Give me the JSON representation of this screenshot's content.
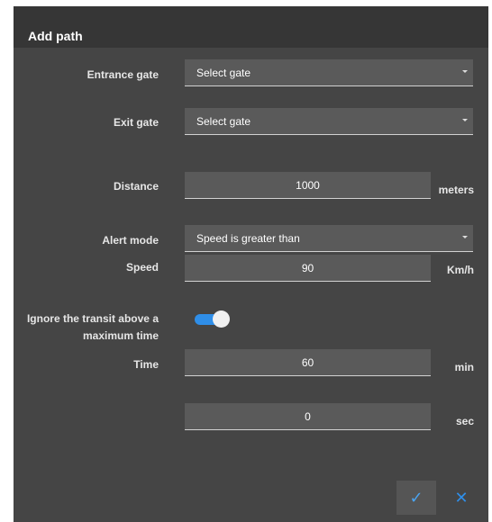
{
  "dialog": {
    "title": "Add path",
    "entrance_gate": {
      "label": "Entrance gate",
      "value": "Select gate"
    },
    "exit_gate": {
      "label": "Exit gate",
      "value": "Select gate"
    },
    "distance": {
      "label": "Distance",
      "value": "1000",
      "unit": "meters"
    },
    "alert_mode": {
      "label": "Alert mode",
      "value": "Speed is greater than"
    },
    "speed": {
      "label": "Speed",
      "value": "90",
      "unit": "Km/h"
    },
    "ignore_transit": {
      "label_line1": "Ignore the transit above a",
      "label_line2": "maximum time",
      "enabled": true
    },
    "time": {
      "label": "Time",
      "minutes": "60",
      "minutes_unit": "min",
      "seconds": "0",
      "seconds_unit": "sec"
    },
    "actions": {
      "confirm_icon": "check-icon",
      "cancel_icon": "close-icon"
    },
    "colors": {
      "accent": "#2f8ee8",
      "background": "#454545",
      "title_bar": "#363636"
    }
  }
}
